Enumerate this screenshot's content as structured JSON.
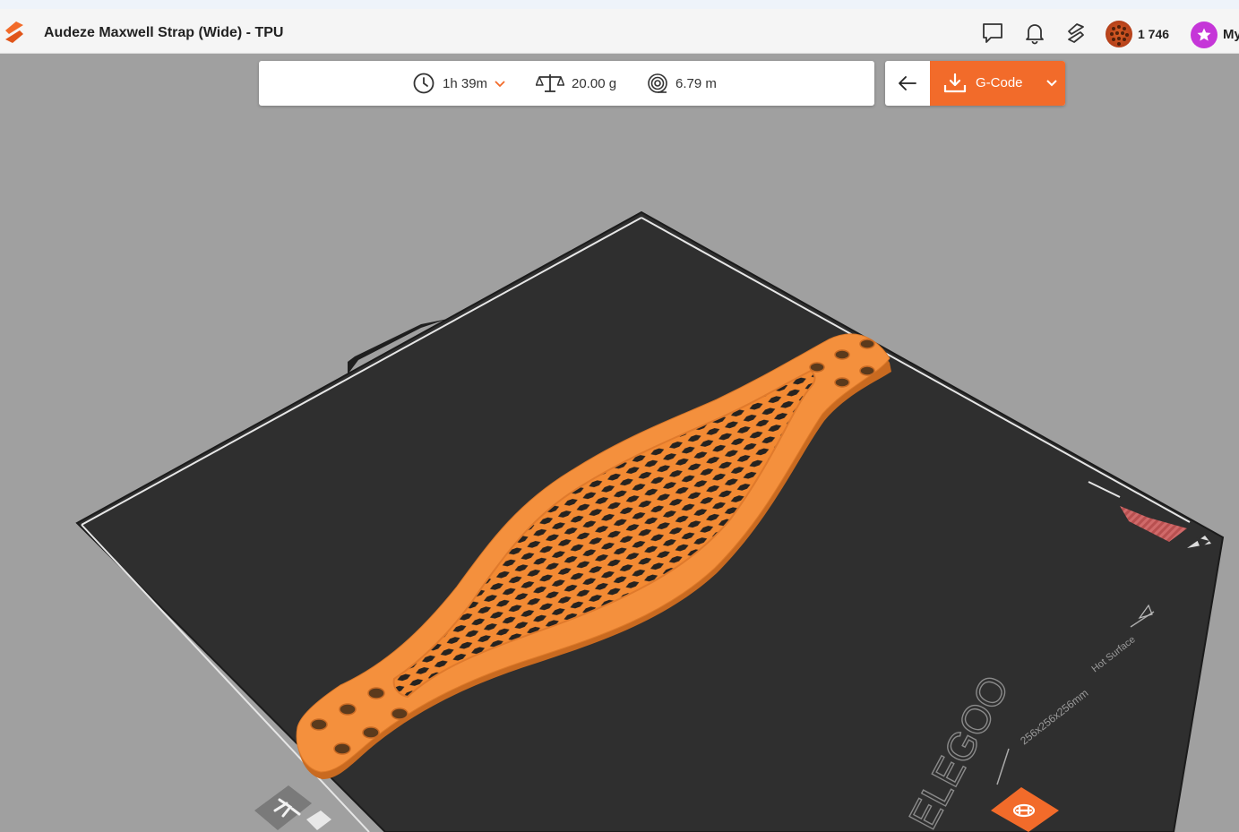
{
  "header": {
    "title": "Audeze Maxwell Strap (Wide) - TPU",
    "coins": "1 746",
    "user_label": "My",
    "icons": [
      "app-logo",
      "comment-icon",
      "bell-icon",
      "slicer-icon",
      "coin-avatar",
      "star-icon"
    ]
  },
  "stats": {
    "time": "1h 39m",
    "weight": "20.00 g",
    "length": "6.79 m"
  },
  "actions": {
    "back_icon": "arrow-left-icon",
    "download_label": "G-Code"
  },
  "build_plate": {
    "brand": "ELEGOO",
    "dimensions": "256x256x256mm",
    "warning": "Hot Surface"
  },
  "colors": {
    "accent": "#f26b2a",
    "model": "#f0883a",
    "plate": "#2e2e2e",
    "background": "#a0a0a0",
    "badge": "#c536d8"
  }
}
